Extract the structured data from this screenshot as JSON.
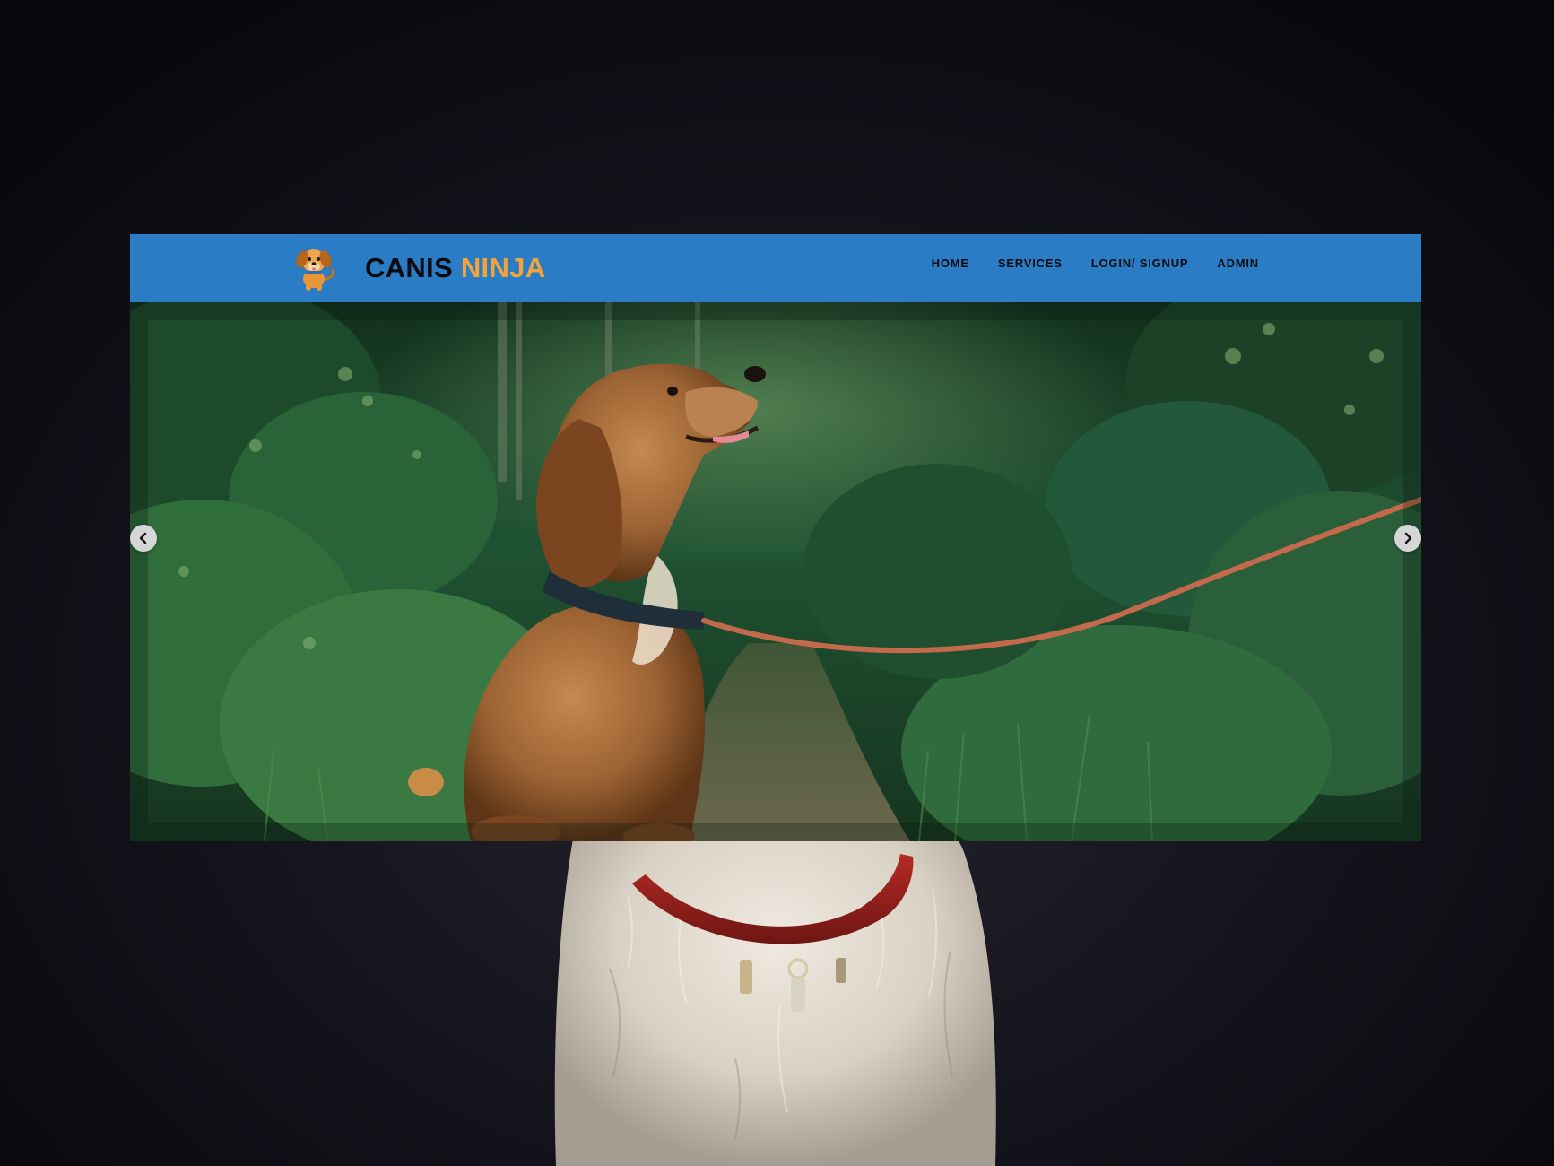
{
  "brand": {
    "name_part1": "CANIS",
    "name_part2": "NINJA",
    "logo_icon": "puppy-icon",
    "colors": {
      "part1": "#0c0c10",
      "part2": "#f2a43b"
    }
  },
  "navbar": {
    "background": "#2a7cc4",
    "links": [
      {
        "label": "HOME"
      },
      {
        "label": "SERVICES"
      },
      {
        "label": "LOGIN/ SIGNUP"
      },
      {
        "label": "ADMIN"
      }
    ]
  },
  "carousel": {
    "slide_image": "dog-on-leash-forest-photo",
    "prev_icon": "chevron-left-icon",
    "next_icon": "chevron-right-icon"
  },
  "background": {
    "image": "white-dog-red-collar-photo"
  }
}
